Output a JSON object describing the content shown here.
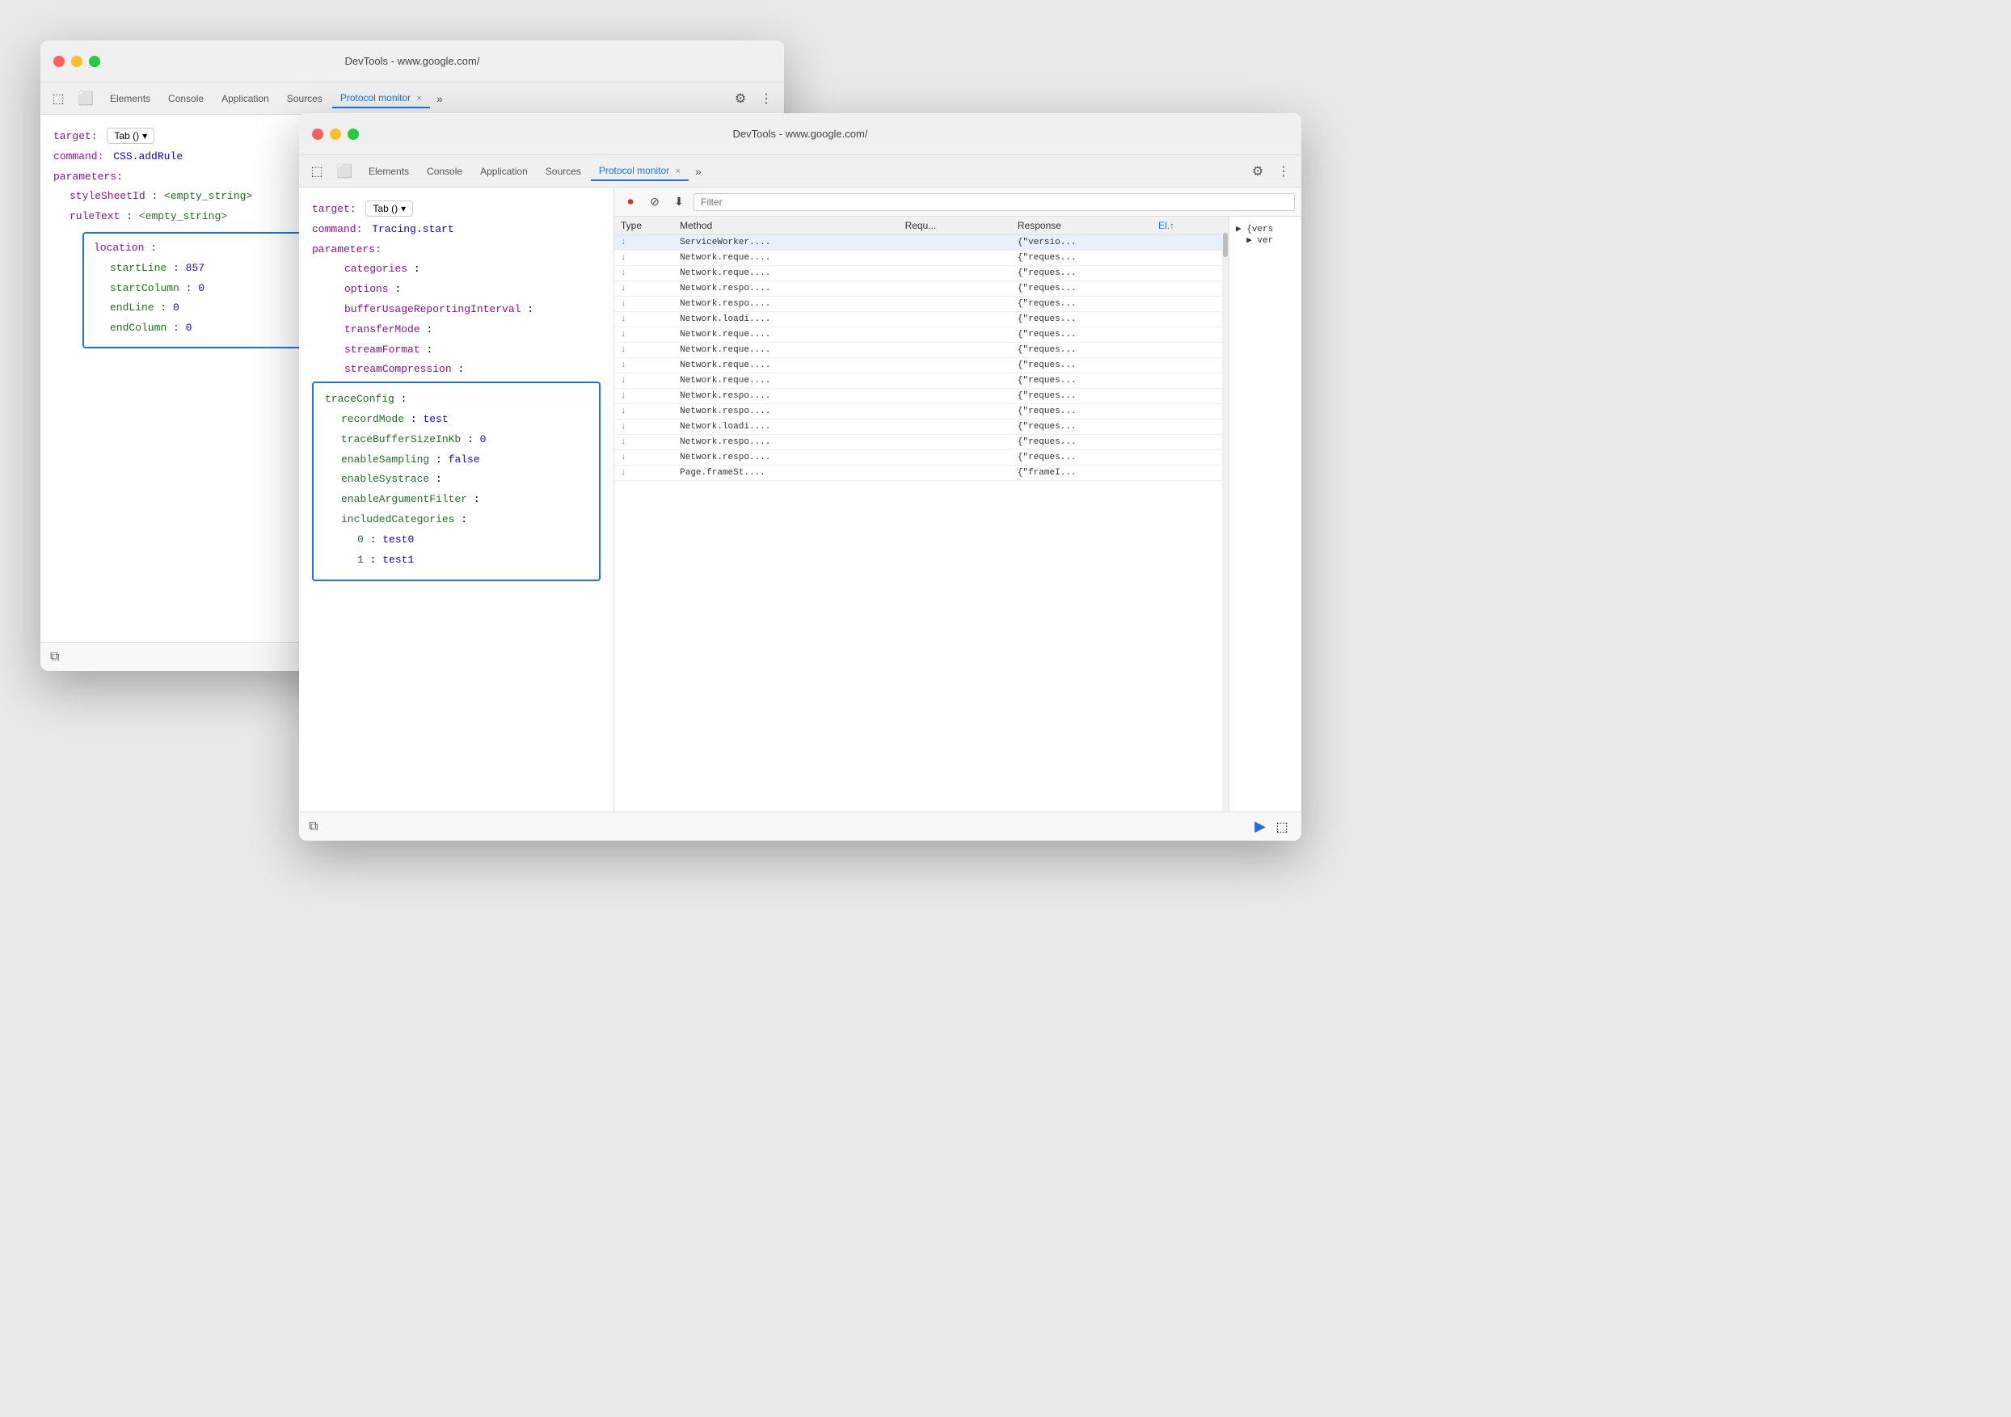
{
  "background_window": {
    "title": "DevTools - www.google.com/",
    "tabs": [
      "Elements",
      "Console",
      "Application",
      "Sources",
      "Protocol monitor"
    ],
    "protocol_tab_active": true,
    "left_panel": {
      "target_label": "target:",
      "target_value": "Tab ()",
      "command_label": "command:",
      "command_value": "CSS.addRule",
      "parameters_label": "parameters:",
      "fields": [
        {
          "key": "styleSheetId",
          "value": "<empty_string>",
          "type": "empty"
        },
        {
          "key": "ruleText",
          "value": "<empty_string>",
          "type": "empty"
        }
      ],
      "location_box": {
        "label": "location :",
        "fields": [
          {
            "key": "startLine",
            "value": "857",
            "type": "number"
          },
          {
            "key": "startColumn",
            "value": "0",
            "type": "number"
          },
          {
            "key": "endLine",
            "value": "0",
            "type": "number"
          },
          {
            "key": "endColumn",
            "value": "0",
            "type": "number"
          }
        ]
      }
    }
  },
  "front_window": {
    "title": "DevTools - www.google.com/",
    "tabs": [
      "Elements",
      "Console",
      "Application",
      "Sources",
      "Protocol monitor"
    ],
    "protocol_tab_active": true,
    "left_panel": {
      "target_label": "target:",
      "target_value": "Tab ()",
      "command_label": "command:",
      "command_value": "Tracing.start",
      "parameters_label": "parameters:",
      "params": [
        {
          "key": "categories",
          "indent": 1
        },
        {
          "key": "options",
          "indent": 1
        },
        {
          "key": "bufferUsageReportingInterval",
          "indent": 1
        },
        {
          "key": "transferMode",
          "indent": 1
        },
        {
          "key": "streamFormat",
          "indent": 1
        },
        {
          "key": "streamCompression",
          "indent": 1
        }
      ],
      "trace_box": {
        "label": "traceConfig :",
        "fields": [
          {
            "key": "recordMode",
            "value": "test",
            "type": "value"
          },
          {
            "key": "traceBufferSizeInKb",
            "value": "0",
            "type": "number"
          },
          {
            "key": "enableSampling",
            "value": "false",
            "type": "value"
          },
          {
            "key": "enableSystrace",
            "indent": 2
          },
          {
            "key": "enableArgumentFilter",
            "indent": 2
          },
          {
            "key": "includedCategories",
            "indent": 2,
            "isParent": true
          },
          {
            "key": "0",
            "value": "test0",
            "type": "value",
            "indent": 3
          },
          {
            "key": "1",
            "value": "test1",
            "type": "value",
            "indent": 3
          }
        ]
      }
    },
    "right_panel": {
      "filter_placeholder": "Filter",
      "columns": [
        "Type",
        "Method",
        "Requ...",
        "Response",
        "El.↑"
      ],
      "rows": [
        {
          "type": "↓",
          "method": "ServiceWorker....",
          "request": "",
          "response": "{\"versio...",
          "el": "",
          "selected": true
        },
        {
          "type": "↓",
          "method": "Network.reque....",
          "request": "",
          "response": "{\"reques...",
          "el": ""
        },
        {
          "type": "↓",
          "method": "Network.reque....",
          "request": "",
          "response": "{\"reques...",
          "el": ""
        },
        {
          "type": "↓",
          "method": "Network.respo....",
          "request": "",
          "response": "{\"reques...",
          "el": ""
        },
        {
          "type": "↓",
          "method": "Network.respo....",
          "request": "",
          "response": "{\"reques...",
          "el": ""
        },
        {
          "type": "↓",
          "method": "Network.loadi....",
          "request": "",
          "response": "{\"reques...",
          "el": ""
        },
        {
          "type": "↓",
          "method": "Network.reque....",
          "request": "",
          "response": "{\"reques...",
          "el": ""
        },
        {
          "type": "↓",
          "method": "Network.reque....",
          "request": "",
          "response": "{\"reques...",
          "el": ""
        },
        {
          "type": "↓",
          "method": "Network.reque....",
          "request": "",
          "response": "{\"reques...",
          "el": ""
        },
        {
          "type": "↓",
          "method": "Network.reque....",
          "request": "",
          "response": "{\"reques...",
          "el": ""
        },
        {
          "type": "↓",
          "method": "Network.respo....",
          "request": "",
          "response": "{\"reques...",
          "el": ""
        },
        {
          "type": "↓",
          "method": "Network.respo....",
          "request": "",
          "response": "{\"reques...",
          "el": ""
        },
        {
          "type": "↓",
          "method": "Network.loadi....",
          "request": "",
          "response": "{\"reques...",
          "el": ""
        },
        {
          "type": "↓",
          "method": "Network.respo....",
          "request": "",
          "response": "{\"reques...",
          "el": ""
        },
        {
          "type": "↓",
          "method": "Network.respo....",
          "request": "",
          "response": "{\"reques...",
          "el": ""
        },
        {
          "type": "↓",
          "method": "Page.frameSt....",
          "request": "",
          "response": "{\"frameI...",
          "el": ""
        }
      ],
      "json_preview": "{\"vers\n▶ ver"
    }
  },
  "icons": {
    "close": "×",
    "chevron": "▾",
    "gear": "⚙",
    "more": "⋮",
    "record_stop": "⏺",
    "block": "⊘",
    "download": "⬇",
    "send": "▶",
    "dock": "⧉",
    "inspect": "⬚",
    "cursor": "⬚",
    "arrow_down": "↓"
  }
}
